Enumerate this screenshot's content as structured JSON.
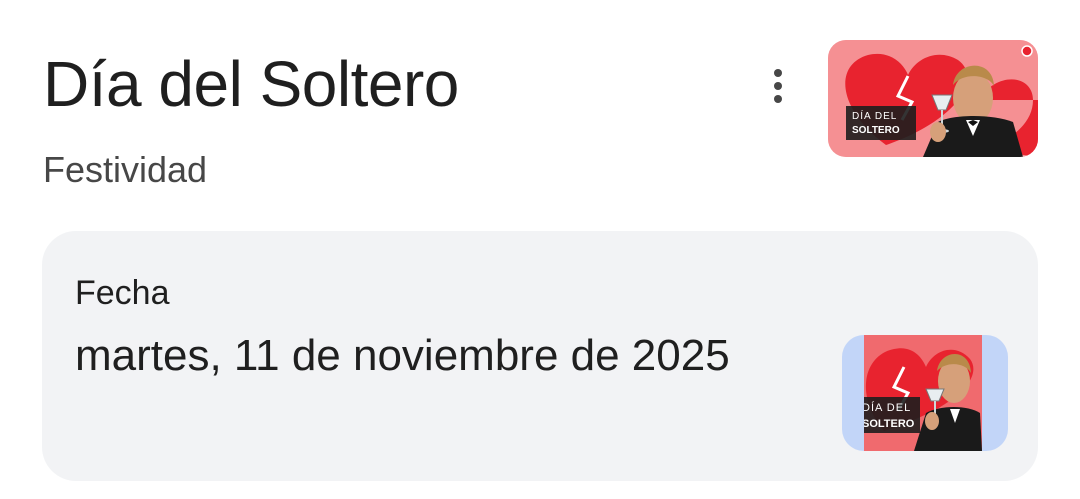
{
  "header": {
    "title": "Día del Soltero",
    "subtitle": "Festividad",
    "thumbnail": {
      "caption_line1": "DÍA DEL",
      "caption_line2": "SOLTERO"
    }
  },
  "date_card": {
    "label": "Fecha",
    "value": "martes, 11 de noviembre de 2025",
    "thumbnail": {
      "caption_line1": "DÍA DEL",
      "caption_line2": "SOLTERO"
    }
  },
  "icons": {
    "more": "more-vert-icon"
  },
  "colors": {
    "card_background": "#f2f3f5",
    "thumb_accent": "#e8232f",
    "thumb_frame": "#c2d5f8"
  }
}
